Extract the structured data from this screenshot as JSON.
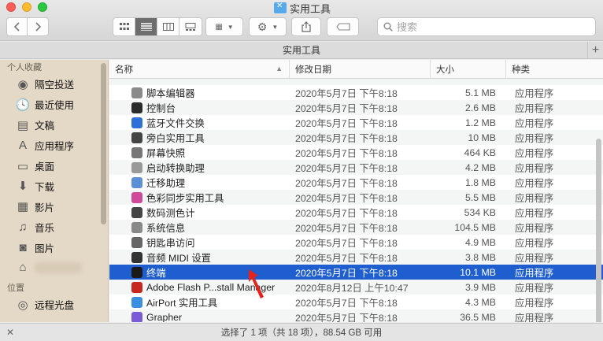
{
  "window": {
    "title": "实用工具"
  },
  "toolbar": {
    "back_icon": "chevron-left-icon",
    "forward_icon": "chevron-right-icon",
    "views": [
      "icon-view",
      "list-view",
      "column-view",
      "gallery-view"
    ],
    "group_icon": "grid-icon",
    "action_icon": "gear-icon",
    "share_icon": "share-icon",
    "tag_icon": "tag-icon",
    "search_placeholder": "搜索"
  },
  "tab": {
    "label": "实用工具"
  },
  "sidebar": {
    "favorites_header": "个人收藏",
    "items": [
      {
        "label": "隔空投送",
        "icon": "airdrop-icon"
      },
      {
        "label": "最近使用",
        "icon": "clock-icon"
      },
      {
        "label": "文稿",
        "icon": "document-icon"
      },
      {
        "label": "应用程序",
        "icon": "applications-icon"
      },
      {
        "label": "桌面",
        "icon": "desktop-icon"
      },
      {
        "label": "下载",
        "icon": "download-icon"
      },
      {
        "label": "影片",
        "icon": "film-icon"
      },
      {
        "label": "音乐",
        "icon": "music-icon"
      },
      {
        "label": "图片",
        "icon": "camera-icon"
      },
      {
        "label": "",
        "icon": "home-icon"
      }
    ],
    "locations_header": "位置",
    "locations": [
      {
        "label": "远程光盘",
        "icon": "disc-icon"
      }
    ]
  },
  "columns": {
    "name": "名称",
    "date": "修改日期",
    "size": "大小",
    "kind": "种类"
  },
  "rows": [
    {
      "name": "脚本编辑器",
      "date": "2020年5月7日 下午8:18",
      "size": "5.1 MB",
      "kind": "应用程序",
      "icon": "script-icon",
      "color": "#8a8a8a"
    },
    {
      "name": "控制台",
      "date": "2020年5月7日 下午8:18",
      "size": "2.6 MB",
      "kind": "应用程序",
      "icon": "console-icon",
      "color": "#2b2b2b"
    },
    {
      "name": "蓝牙文件交换",
      "date": "2020年5月7日 下午8:18",
      "size": "1.2 MB",
      "kind": "应用程序",
      "icon": "bluetooth-icon",
      "color": "#2f6fd8"
    },
    {
      "name": "旁白实用工具",
      "date": "2020年5月7日 下午8:18",
      "size": "10 MB",
      "kind": "应用程序",
      "icon": "voiceover-icon",
      "color": "#444444"
    },
    {
      "name": "屏幕快照",
      "date": "2020年5月7日 下午8:18",
      "size": "464 KB",
      "kind": "应用程序",
      "icon": "screenshot-icon",
      "color": "#777777"
    },
    {
      "name": "启动转换助理",
      "date": "2020年5月7日 下午8:18",
      "size": "4.2 MB",
      "kind": "应用程序",
      "icon": "bootcamp-icon",
      "color": "#999999"
    },
    {
      "name": "迁移助理",
      "date": "2020年5月7日 下午8:18",
      "size": "1.8 MB",
      "kind": "应用程序",
      "icon": "migration-icon",
      "color": "#5b8fd6"
    },
    {
      "name": "色彩同步实用工具",
      "date": "2020年5月7日 下午8:18",
      "size": "5.5 MB",
      "kind": "应用程序",
      "icon": "colorsync-icon",
      "color": "#d04a9a"
    },
    {
      "name": "数码测色计",
      "date": "2020年5月7日 下午8:18",
      "size": "534 KB",
      "kind": "应用程序",
      "icon": "colormeter-icon",
      "color": "#444444"
    },
    {
      "name": "系统信息",
      "date": "2020年5月7日 下午8:18",
      "size": "104.5 MB",
      "kind": "应用程序",
      "icon": "sysinfo-icon",
      "color": "#888888"
    },
    {
      "name": "钥匙串访问",
      "date": "2020年5月7日 下午8:18",
      "size": "4.9 MB",
      "kind": "应用程序",
      "icon": "keychain-icon",
      "color": "#666666"
    },
    {
      "name": "音频 MIDI 设置",
      "date": "2020年5月7日 下午8:18",
      "size": "3.8 MB",
      "kind": "应用程序",
      "icon": "midi-icon",
      "color": "#333333"
    },
    {
      "name": "终端",
      "date": "2020年5月7日 下午8:18",
      "size": "10.1 MB",
      "kind": "应用程序",
      "icon": "terminal-icon",
      "color": "#1a1a1a",
      "selected": true
    },
    {
      "name": "Adobe Flash P...stall Manager",
      "date": "2020年8月12日 上午10:47",
      "size": "3.9 MB",
      "kind": "应用程序",
      "icon": "flash-icon",
      "color": "#c8271f"
    },
    {
      "name": "AirPort 实用工具",
      "date": "2020年5月7日 下午8:18",
      "size": "4.3 MB",
      "kind": "应用程序",
      "icon": "airport-icon",
      "color": "#3a8fe0"
    },
    {
      "name": "Grapher",
      "date": "2020年5月7日 下午8:18",
      "size": "36.5 MB",
      "kind": "应用程序",
      "icon": "grapher-icon",
      "color": "#7b5bd6"
    }
  ],
  "status": {
    "text": "选择了 1 项（共 18 项），88.54 GB 可用"
  }
}
